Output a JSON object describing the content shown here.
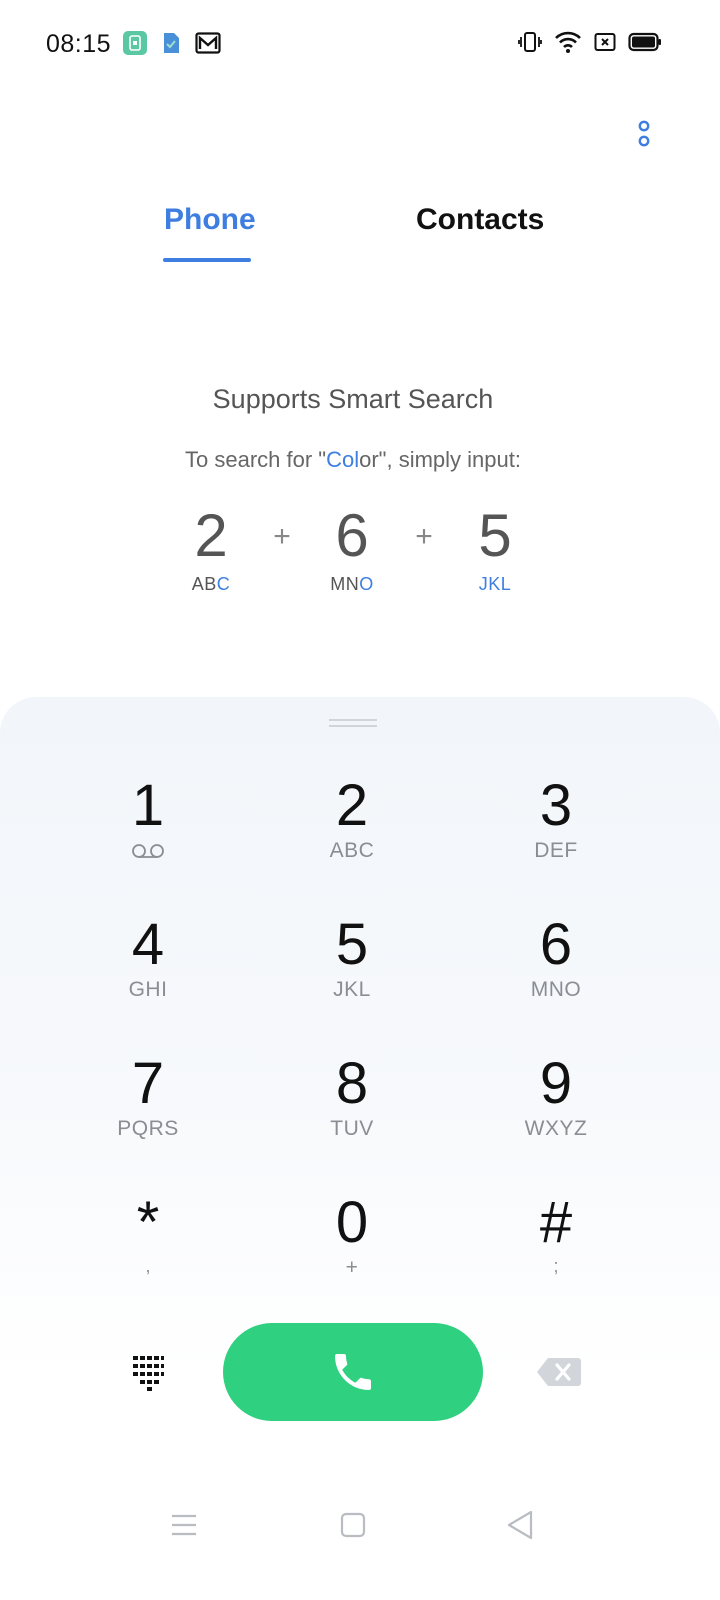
{
  "status_bar": {
    "time": "08:15"
  },
  "tabs": [
    {
      "label": "Phone"
    },
    {
      "label": "Contacts"
    }
  ],
  "hint": {
    "title": "Supports Smart Search",
    "subtitle_prefix": "To search for \"",
    "subtitle_highlight": "Col",
    "subtitle_rest": "or\", simply input:",
    "examples": [
      {
        "digit": "2",
        "letters_plain": "AB",
        "letters_highlight": "C"
      },
      {
        "digit": "6",
        "letters_plain": "MN",
        "letters_highlight": "O"
      },
      {
        "digit": "5",
        "letters_plain": "",
        "letters_highlight": "JKL"
      }
    ],
    "plus": "+"
  },
  "dialpad": {
    "keys": [
      {
        "digit": "1",
        "letters": ""
      },
      {
        "digit": "2",
        "letters": "ABC"
      },
      {
        "digit": "3",
        "letters": "DEF"
      },
      {
        "digit": "4",
        "letters": "GHI"
      },
      {
        "digit": "5",
        "letters": "JKL"
      },
      {
        "digit": "6",
        "letters": "MNO"
      },
      {
        "digit": "7",
        "letters": "PQRS"
      },
      {
        "digit": "8",
        "letters": "TUV"
      },
      {
        "digit": "9",
        "letters": "WXYZ"
      },
      {
        "digit": "*",
        "letters": ","
      },
      {
        "digit": "0",
        "letters": "+"
      },
      {
        "digit": "#",
        "letters": ";"
      }
    ]
  },
  "colors": {
    "accent": "#3d7ee0",
    "call_green": "#2fd07f"
  },
  "icons": {
    "voicemail": "voicemail-icon",
    "call": "phone-handset-icon",
    "backspace": "backspace-icon",
    "dialpad": "dialpad-grid-icon",
    "overflow": "overflow-menu-icon"
  }
}
